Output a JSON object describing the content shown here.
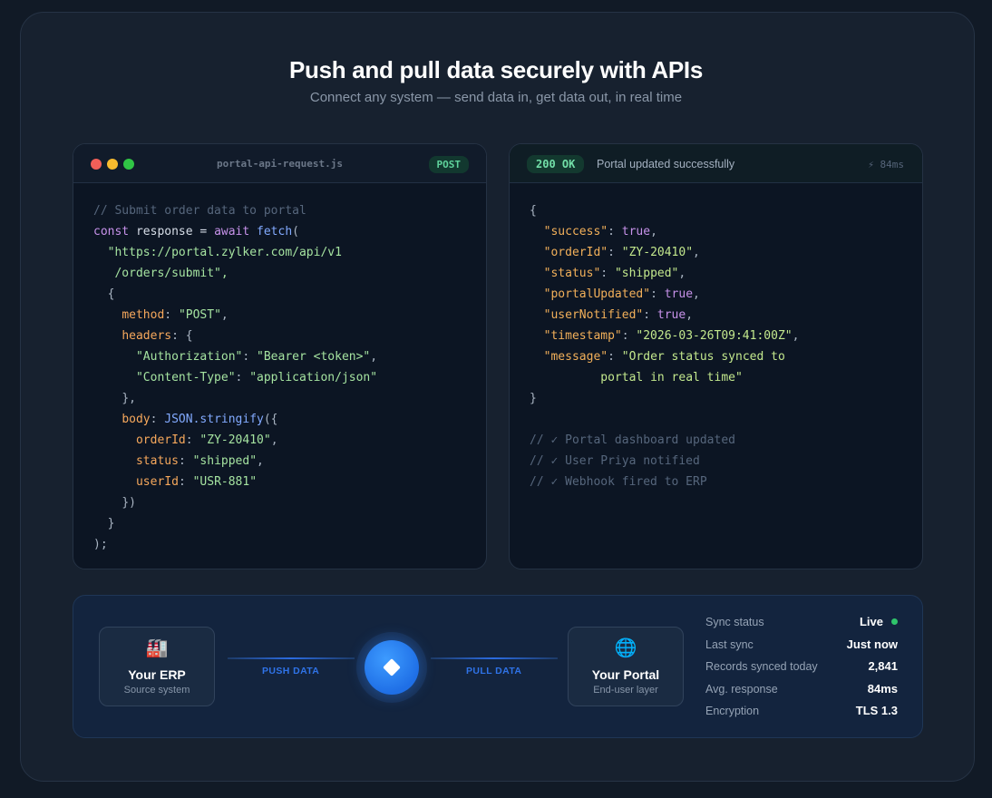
{
  "header": {
    "title": "Push and pull data securely with APIs",
    "subtitle": "Connect any system — send data in, get data out, in real time"
  },
  "request_panel": {
    "filename": "portal-api-request.js",
    "method": "POST",
    "lines": {
      "l1": "// Submit order data to portal",
      "l2a": "const",
      "l2b": " response = ",
      "l2c": "await",
      "l2d": " fetch",
      "l2e": "(",
      "l3": "\"https://portal.zylker.com/api/v1",
      "l4": "/orders/submit\",",
      "l5": "{",
      "l6a": "method",
      "l6b": ": ",
      "l6c": "\"POST\"",
      "l6d": ",",
      "l7a": "headers",
      "l7b": ": {",
      "l8a": "\"Authorization\"",
      "l8b": ": ",
      "l8c": "\"Bearer <token>\"",
      "l8d": ",",
      "l9a": "\"Content-Type\"",
      "l9b": ": ",
      "l9c": "\"application/json\"",
      "l10": "},",
      "l11a": "body",
      "l11b": ": ",
      "l11c": "JSON.stringify",
      "l11d": "({",
      "l12a": "orderId",
      "l12b": ": ",
      "l12c": "\"ZY-20410\"",
      "l12d": ",",
      "l13a": "status",
      "l13b": ": ",
      "l13c": "\"shipped\"",
      "l13d": ",",
      "l14a": "userId",
      "l14b": ": ",
      "l14c": "\"USR-881\"",
      "l15": "})",
      "l16": "}",
      "l17": ");"
    }
  },
  "response_panel": {
    "status_code": "200 OK",
    "status_text": "Portal updated successfully",
    "latency": "⚡ 84ms",
    "lines": {
      "open": "{",
      "r1k": "\"success\"",
      "r1v": "true",
      "r2k": "\"orderId\"",
      "r2v": "\"ZY-20410\"",
      "r3k": "\"status\"",
      "r3v": "\"shipped\"",
      "r4k": "\"portalUpdated\"",
      "r4v": "true",
      "r5k": "\"userNotified\"",
      "r5v": "true",
      "r6k": "\"timestamp\"",
      "r6v": "\"2026-03-26T09:41:00Z\"",
      "r7k": "\"message\"",
      "r7v": "\"Order status synced to",
      "r7v2": "portal in real time\"",
      "close": "}",
      "c1": "// ✓ Portal dashboard updated",
      "c2": "// ✓ User Priya notified",
      "c3": "// ✓ Webhook fired to ERP"
    }
  },
  "flow": {
    "erp": {
      "icon": "🏭",
      "title": "Your ERP",
      "subtitle": "Source system"
    },
    "portal": {
      "icon": "🌐",
      "title": "Your Portal",
      "subtitle": "End-user layer"
    },
    "push_label": "PUSH DATA",
    "pull_label": "PULL DATA",
    "hub_icon": "diamond-icon"
  },
  "stats": [
    {
      "label": "Sync status",
      "value": "Live"
    },
    {
      "label": "Last sync",
      "value": "Just now"
    },
    {
      "label": "Records synced today",
      "value": "2,841"
    },
    {
      "label": "Avg. response",
      "value": "84ms"
    },
    {
      "label": "Encryption",
      "value": "TLS 1.3"
    }
  ],
  "colors": {
    "background": "#111a26",
    "accent": "#2f73e8",
    "success": "#5fd39c",
    "live": "#2fc46b"
  }
}
